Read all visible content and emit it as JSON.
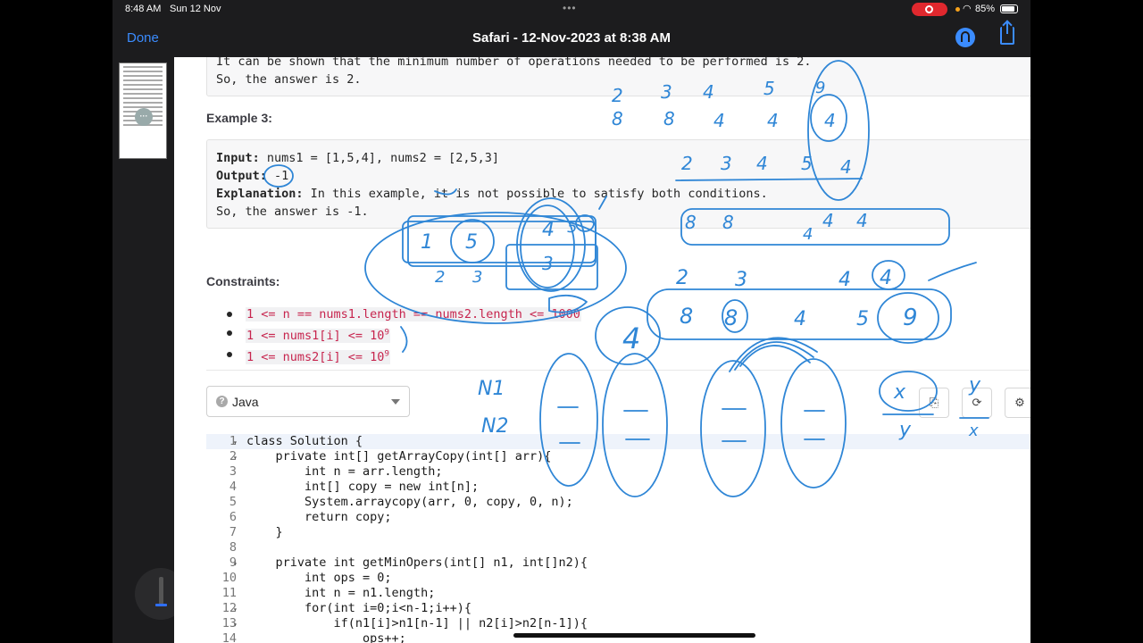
{
  "status": {
    "time": "8:48 AM",
    "date": "Sun 12 Nov",
    "battery": "85%"
  },
  "nav": {
    "done_label": "Done",
    "title": "Safari - 12-Nov-2023 at 8:38 AM"
  },
  "thumbnail": {
    "more_label": "···"
  },
  "doc": {
    "example2_tail": [
      "It can be shown that the minimum number of operations needed to be performed is 2.",
      "So, the answer is 2."
    ],
    "example3_heading": "Example 3:",
    "example3": {
      "input_label": "Input:",
      "input_value": " nums1 = [1,5,4], nums2 = [2,5,3]",
      "output_label": "Output:",
      "output_value": " -1",
      "explanation_label": "Explanation:",
      "explanation_value": " In this example, it is not possible to satisfy both conditions.",
      "last_line": "So, the answer is -1."
    },
    "constraints_heading": "Constraints:",
    "constraints": [
      {
        "text": "1 <= n == nums1.length == nums2.length <= 1000",
        "sup": ""
      },
      {
        "text": "1 <= nums1[i] <= 10",
        "sup": "9"
      },
      {
        "text": "1 <= nums2[i] <= 10",
        "sup": "9"
      }
    ],
    "language": "Java",
    "code_lines": [
      {
        "n": "1",
        "fold": "▾",
        "text": "class Solution {"
      },
      {
        "n": "2",
        "fold": "▾",
        "text": "    private int[] getArrayCopy(int[] arr){"
      },
      {
        "n": "3",
        "fold": "",
        "text": "        int n = arr.length;"
      },
      {
        "n": "4",
        "fold": "",
        "text": "        int[] copy = new int[n];"
      },
      {
        "n": "5",
        "fold": "",
        "text": "        System.arraycopy(arr, 0, copy, 0, n);"
      },
      {
        "n": "6",
        "fold": "",
        "text": "        return copy;"
      },
      {
        "n": "7",
        "fold": "",
        "text": "    }"
      },
      {
        "n": "8",
        "fold": "",
        "text": ""
      },
      {
        "n": "9",
        "fold": "▾",
        "text": "    private int getMinOpers(int[] n1, int[]n2){"
      },
      {
        "n": "10",
        "fold": "",
        "text": "        int ops = 0;"
      },
      {
        "n": "11",
        "fold": "",
        "text": "        int n = n1.length;"
      },
      {
        "n": "12",
        "fold": "▾",
        "text": "        for(int i=0;i<n-1;i++){"
      },
      {
        "n": "13",
        "fold": "▾",
        "text": "            if(n1[i]>n1[n-1] || n2[i]>n2[n-1]){"
      },
      {
        "n": "14",
        "fold": "",
        "text": "                ops++;"
      }
    ]
  },
  "ink": {
    "top_row1": [
      "2",
      "3",
      "4",
      "5",
      "9"
    ],
    "top_row2": [
      "8",
      "8",
      "4",
      "4",
      "4"
    ],
    "top_row3": [
      "2",
      "3",
      "4",
      "5",
      "4"
    ],
    "bar_row": [
      "8",
      "8",
      "4",
      "4",
      "4"
    ],
    "mid_row1": [
      "2",
      "3",
      "4",
      "4"
    ],
    "mid_row2": [
      "8",
      "8",
      "4",
      "5",
      "9"
    ],
    "left_box": [
      "1",
      "5",
      "4",
      "5",
      "3",
      "2",
      "3"
    ],
    "circled_four": "4",
    "n_labels": [
      "N1",
      "N2"
    ],
    "fraction": [
      "x",
      "y",
      "y",
      "x"
    ]
  },
  "colors": {
    "ink": "#2f86d6",
    "accent": "#3b8cff",
    "record": "#e0282e",
    "code_highlight": "#c7254e"
  }
}
